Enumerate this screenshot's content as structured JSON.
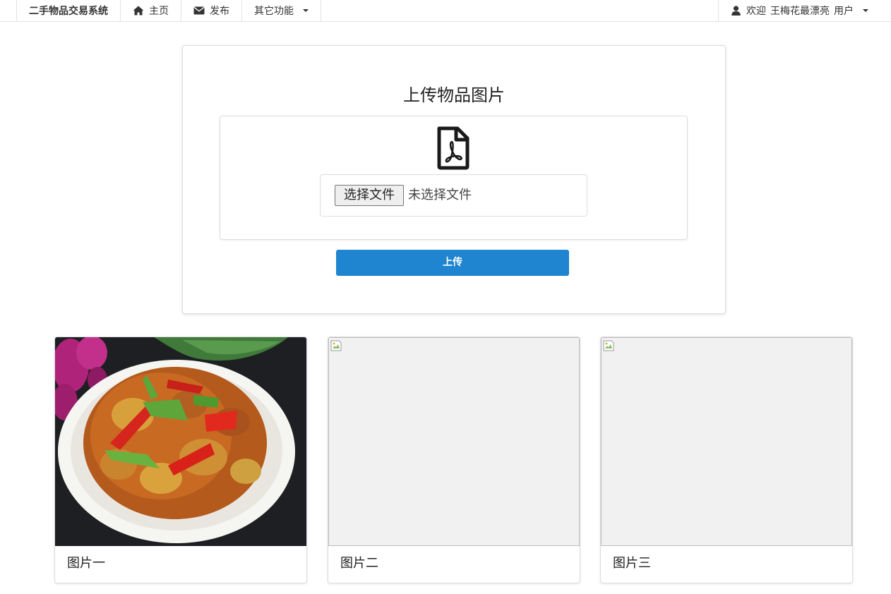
{
  "navbar": {
    "brand": "二手物品交易系统",
    "items": [
      {
        "label": "主页",
        "icon": "home-icon"
      },
      {
        "label": "发布",
        "icon": "envelope-icon"
      }
    ],
    "dropdown_label": "其它功能",
    "user": {
      "prefix": "欢迎",
      "name": "王梅花最漂亮",
      "role": "用户",
      "icon": "user-icon"
    }
  },
  "upload": {
    "title": "上传物品图片",
    "file_icon": "pdf-file-icon",
    "choose_button": "选择文件",
    "no_file_text": "未选择文件",
    "submit_label": "上传",
    "accent_color": "#1f85d0"
  },
  "gallery": [
    {
      "caption": "图片一",
      "image": "braised-eggplant-with-peppers-photo"
    },
    {
      "caption": "图片二",
      "image": "broken-image"
    },
    {
      "caption": "图片三",
      "image": "broken-image"
    }
  ]
}
